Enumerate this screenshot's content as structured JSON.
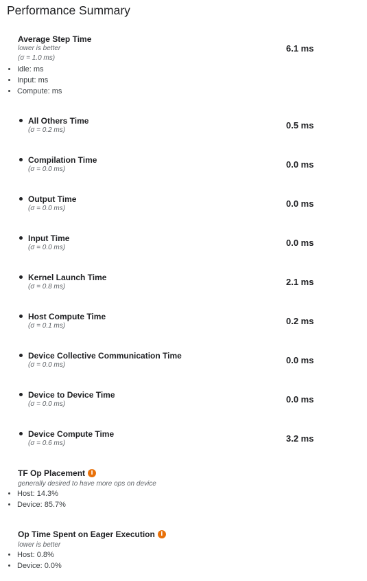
{
  "page": {
    "title": "Performance Summary"
  },
  "avg_step": {
    "label": "Average Step Time",
    "hint": "lower is better",
    "sigma": "(σ = 1.0 ms)",
    "value": "6.1 ms",
    "breakdown": [
      "Idle: ms",
      "Input: ms",
      "Compute: ms"
    ]
  },
  "metrics": [
    {
      "label": "All Others Time",
      "sigma": "(σ = 0.2 ms)",
      "value": "0.5 ms"
    },
    {
      "label": "Compilation Time",
      "sigma": "(σ = 0.0 ms)",
      "value": "0.0 ms"
    },
    {
      "label": "Output Time",
      "sigma": "(σ = 0.0 ms)",
      "value": "0.0 ms"
    },
    {
      "label": "Input Time",
      "sigma": "(σ = 0.0 ms)",
      "value": "0.0 ms"
    },
    {
      "label": "Kernel Launch Time",
      "sigma": "(σ = 0.8 ms)",
      "value": "2.1 ms"
    },
    {
      "label": "Host Compute Time",
      "sigma": "(σ = 0.1 ms)",
      "value": "0.2 ms"
    },
    {
      "label": "Device Collective Communication Time",
      "sigma": "(σ = 0.0 ms)",
      "value": "0.0 ms"
    },
    {
      "label": "Device to Device Time",
      "sigma": "(σ = 0.0 ms)",
      "value": "0.0 ms"
    },
    {
      "label": "Device Compute Time",
      "sigma": "(σ = 0.6 ms)",
      "value": "3.2 ms"
    }
  ],
  "tf_op_placement": {
    "label": "TF Op Placement",
    "hint": "generally desired to have more ops on device",
    "items": [
      "Host: 14.3%",
      "Device: 85.7%"
    ],
    "icon": "info-icon",
    "icon_glyph": "i"
  },
  "eager_execution": {
    "label": "Op Time Spent on Eager Execution",
    "hint": "lower is better",
    "items": [
      "Host: 0.8%",
      "Device: 0.0%"
    ],
    "icon": "info-icon",
    "icon_glyph": "i"
  },
  "colors": {
    "accent": "#e8710a",
    "text": "#202124",
    "muted": "#5f6368"
  }
}
